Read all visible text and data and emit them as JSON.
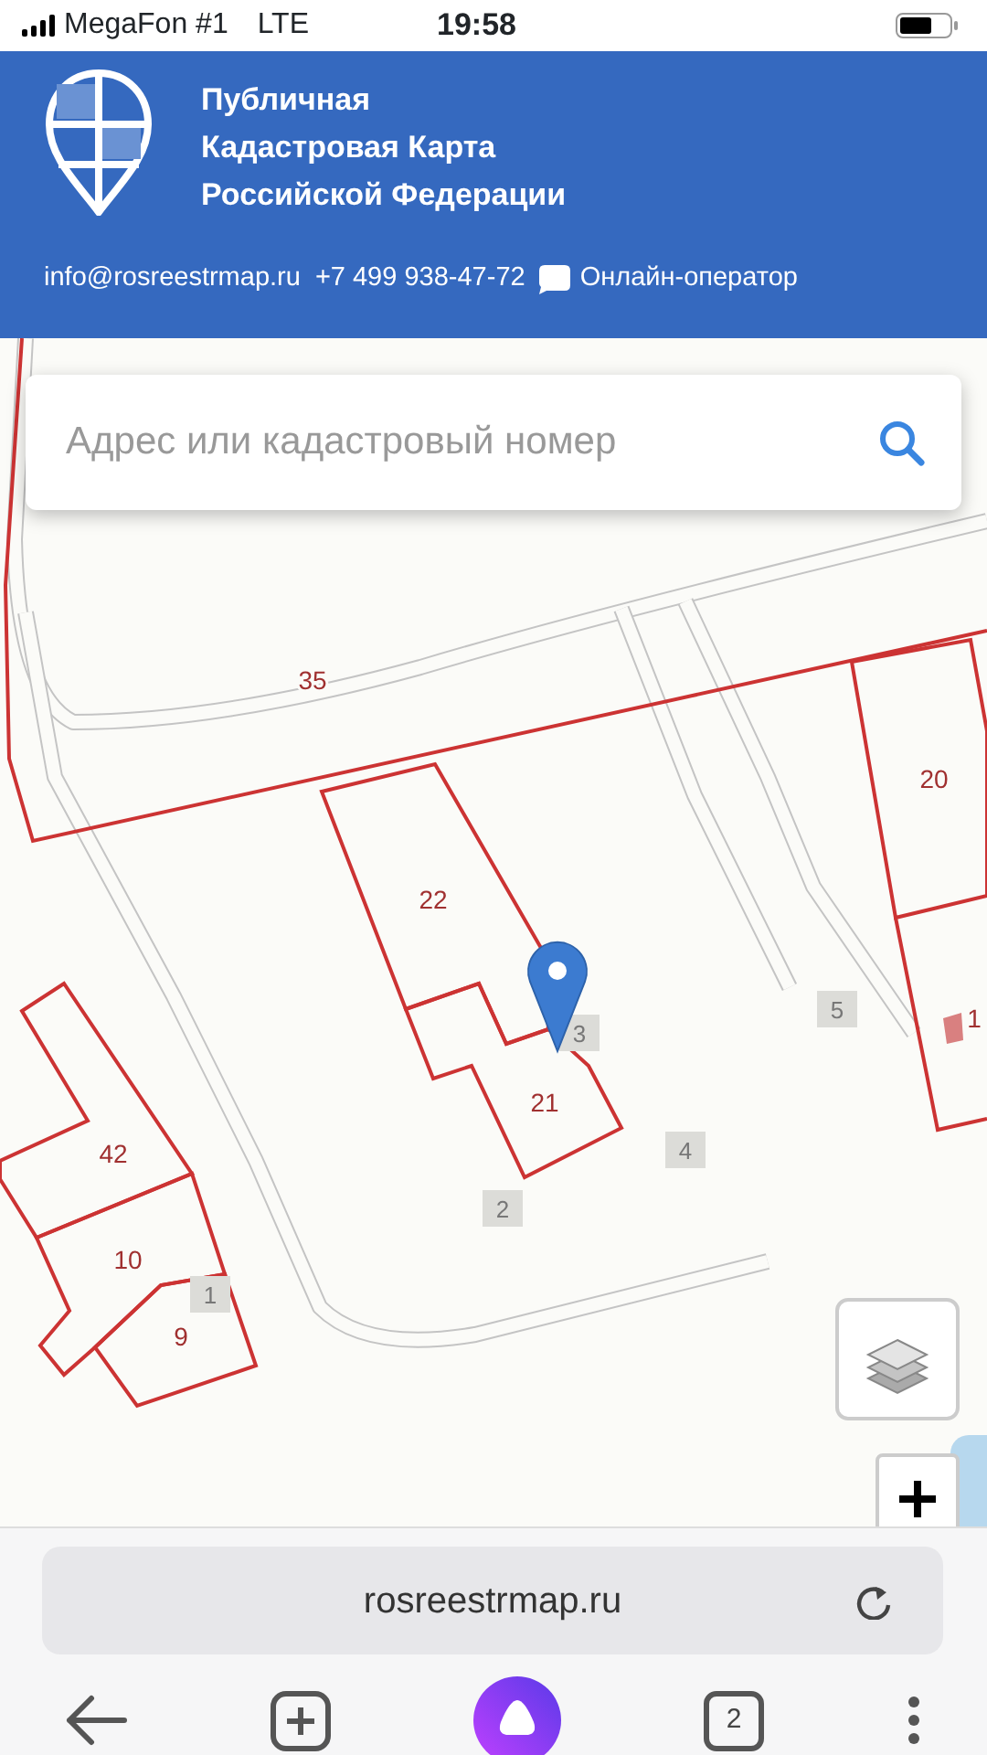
{
  "status_bar": {
    "carrier": "MegaFon #1",
    "network": "LTE",
    "time": "19:58"
  },
  "header": {
    "title_lines": [
      "Публичная",
      "Кадастровая Карта",
      "Российской Федерации"
    ],
    "email": "info@rosreestrmap.ru",
    "phone": "+7 499 938-47-72",
    "chat": "Онлайн-оператор"
  },
  "search": {
    "placeholder": "Адрес или кадастровый номер"
  },
  "map": {
    "plot_labels": [
      "35",
      "22",
      "21",
      "20",
      "42",
      "10",
      "9",
      "1"
    ],
    "house_numbers": [
      "3",
      "5",
      "4",
      "2",
      "1"
    ]
  },
  "browser": {
    "url": "rosreestrmap.ru",
    "tab_count": "2"
  }
}
